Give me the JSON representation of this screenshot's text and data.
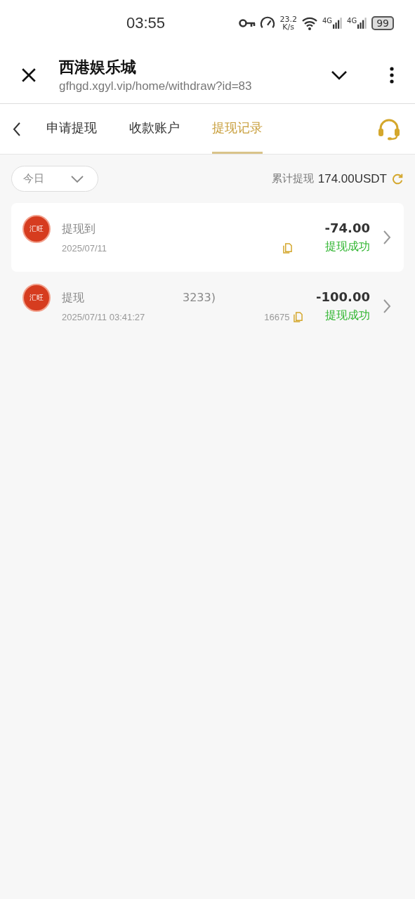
{
  "status_bar": {
    "time": "03:55",
    "speed": "23.2",
    "speed_unit": "K/s",
    "battery": "99",
    "network": [
      "4G",
      "4G"
    ]
  },
  "browser": {
    "title": "西港娱乐城",
    "url": "gfhgd.xgyl.vip/home/withdraw?id=83"
  },
  "tabs": [
    {
      "label": "申请提现",
      "selected": false
    },
    {
      "label": "收款账户",
      "selected": false
    },
    {
      "label": "提现记录",
      "selected": true
    }
  ],
  "filter": {
    "value": "今日"
  },
  "total": {
    "label": "累计提现",
    "value": "174.00USDT"
  },
  "records": [
    {
      "logo_text": "汇旺",
      "title": "提现到",
      "date": "2025/07/11",
      "amount": "-74.00",
      "status": "提现成功",
      "highlighted": true
    },
    {
      "logo_text": "汇旺",
      "title": "提现",
      "title_fragment": "3233)",
      "date": "2025/07/11 03:41:27",
      "number_fragment": "16675",
      "amount": "-100.00",
      "status": "提现成功",
      "highlighted": false
    }
  ]
}
